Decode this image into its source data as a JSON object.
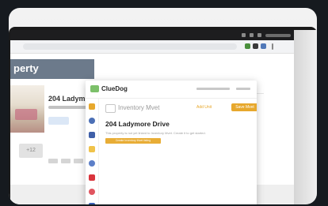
{
  "background_page": {
    "header_title": "perty",
    "listing_title": "204 Ladym",
    "photo_count": "+12"
  },
  "extension": {
    "brand": "ClueDog",
    "page_title": "Inventory Mvet",
    "secondary_action": "Add Unit",
    "primary_action": "Save Mvet",
    "address": "204 Ladymore Drive",
    "description": "This property is not yet linked to Inventory Mvet. Create it to get started.",
    "create_button": "Create Inventory Mvet listing"
  },
  "colors": {
    "accent_orange": "#e7a82d",
    "brand_green": "#7cc06a",
    "header_slate": "#6c7a8b"
  },
  "sidebar_icons": [
    "home-icon",
    "globe-icon",
    "swap-icon",
    "tag-icon",
    "key-icon",
    "k-icon",
    "lifebuoy-icon",
    "flame-icon"
  ]
}
